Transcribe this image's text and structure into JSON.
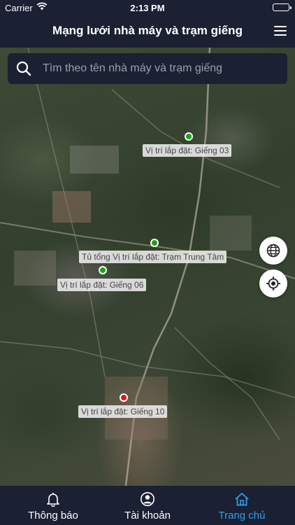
{
  "status_bar": {
    "carrier": "Carrier",
    "time": "2:13 PM"
  },
  "header": {
    "title": "Mạng lưới nhà máy và trạm giếng",
    "menu_icon": "hamburger-menu-icon"
  },
  "search": {
    "placeholder": "Tìm theo tên nhà máy và trạm giếng",
    "value": ""
  },
  "map": {
    "markers": [
      {
        "label": "Vị trí lắp đặt: Giếng 03",
        "status_color": "#1aa31a"
      },
      {
        "label": "Tủ tổng Vị trí lắp đặt: Trạm Trung Tâm",
        "status_color": "#1aa31a"
      },
      {
        "label": "Vị trí lắp đặt: Giếng 06",
        "status_color": "#1aa31a"
      },
      {
        "label": "Vị trí lắp đặt: Giếng 10",
        "status_color": "#e0141e"
      }
    ],
    "controls": {
      "layers_icon": "globe-icon",
      "locate_icon": "my-location-icon"
    }
  },
  "tabs": [
    {
      "label": "Thông báo",
      "icon": "bell-icon",
      "active": false
    },
    {
      "label": "Tài khoản",
      "icon": "user-circle-icon",
      "active": false
    },
    {
      "label": "Trang chủ",
      "icon": "home-icon",
      "active": true
    }
  ],
  "colors": {
    "bar_background": "#1b2033",
    "active_tab": "#2f9ff0"
  }
}
